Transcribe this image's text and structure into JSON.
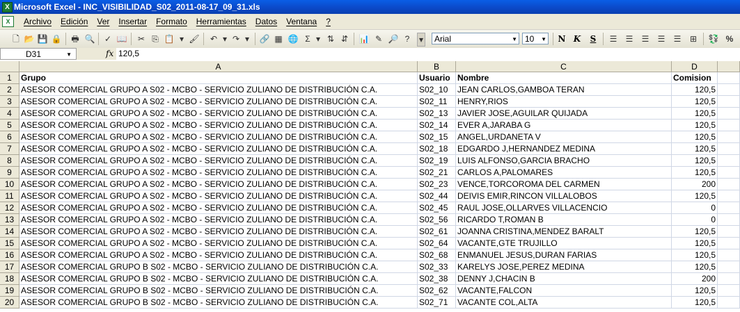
{
  "window": {
    "title": "Microsoft Excel - INC_VISIBILIDAD_S02_2011-08-17_09_31.xls"
  },
  "menu": [
    "Archivo",
    "Edición",
    "Ver",
    "Insertar",
    "Formato",
    "Herramientas",
    "Datos",
    "Ventana",
    "?"
  ],
  "toolbar": {
    "font": "Arial",
    "size": "10",
    "bold": "N",
    "italic": "K",
    "underline": "S",
    "percent": "%",
    "sum": "Σ"
  },
  "formula_bar": {
    "cell_ref": "D31",
    "fx": "fx",
    "value": "120,5"
  },
  "sheet": {
    "columns": [
      "A",
      "B",
      "C",
      "D"
    ],
    "header_row": [
      "Grupo",
      "Usuario",
      "Nombre",
      "Comision"
    ],
    "rows": [
      [
        "ASESOR COMERCIAL GRUPO A S02 - MCBO - SERVICIO ZULIANO DE DISTRIBUCIÓN C.A.",
        "S02_10",
        "JEAN  CARLOS,GAMBOA TERAN",
        "120,5"
      ],
      [
        "ASESOR COMERCIAL GRUPO A S02 - MCBO - SERVICIO ZULIANO DE DISTRIBUCIÓN C.A.",
        "S02_11",
        "HENRY,RIOS",
        "120,5"
      ],
      [
        "ASESOR COMERCIAL GRUPO A S02 - MCBO - SERVICIO ZULIANO DE DISTRIBUCIÓN C.A.",
        "S02_13",
        "JAVIER JOSE,AGUILAR QUIJADA",
        "120,5"
      ],
      [
        "ASESOR COMERCIAL GRUPO A S02 - MCBO - SERVICIO ZULIANO DE DISTRIBUCIÓN C.A.",
        "S02_14",
        "EVER A,JARABA G",
        "120,5"
      ],
      [
        "ASESOR COMERCIAL GRUPO A S02 - MCBO - SERVICIO ZULIANO DE DISTRIBUCIÓN C.A.",
        "S02_15",
        "ANGEL,URDANETA V",
        "120,5"
      ],
      [
        "ASESOR COMERCIAL GRUPO A S02 - MCBO - SERVICIO ZULIANO DE DISTRIBUCIÓN C.A.",
        "S02_18",
        "EDGARDO J,HERNANDEZ MEDINA",
        "120,5"
      ],
      [
        "ASESOR COMERCIAL GRUPO A S02 - MCBO - SERVICIO ZULIANO DE DISTRIBUCIÓN C.A.",
        "S02_19",
        "LUIS ALFONSO,GARCIA BRACHO",
        "120,5"
      ],
      [
        "ASESOR COMERCIAL GRUPO A S02 - MCBO - SERVICIO ZULIANO DE DISTRIBUCIÓN C.A.",
        "S02_21",
        "CARLOS A,PALOMARES",
        "120,5"
      ],
      [
        "ASESOR COMERCIAL GRUPO A S02 - MCBO - SERVICIO ZULIANO DE DISTRIBUCIÓN C.A.",
        "S02_23",
        "VENCE,TORCOROMA DEL CARMEN",
        "200"
      ],
      [
        "ASESOR COMERCIAL GRUPO A S02 - MCBO - SERVICIO ZULIANO DE DISTRIBUCIÓN C.A.",
        "S02_44",
        "DEIVIS EMIR,RINCON VILLALOBOS",
        "120,5"
      ],
      [
        "ASESOR COMERCIAL GRUPO A S02 - MCBO - SERVICIO ZULIANO DE DISTRIBUCIÓN C.A.",
        "S02_45",
        "RAUL JOSE,OLLARVES VILLACENCIO",
        "0"
      ],
      [
        "ASESOR COMERCIAL GRUPO A S02 - MCBO - SERVICIO ZULIANO DE DISTRIBUCIÓN C.A.",
        "S02_56",
        "RICARDO T,ROMAN B",
        "0"
      ],
      [
        "ASESOR COMERCIAL GRUPO A S02 - MCBO - SERVICIO ZULIANO DE DISTRIBUCIÓN C.A.",
        "S02_61",
        "JOANNA CRISTINA,MENDEZ BARALT",
        "120,5"
      ],
      [
        "ASESOR COMERCIAL GRUPO A S02 - MCBO - SERVICIO ZULIANO DE DISTRIBUCIÓN C.A.",
        "S02_64",
        "VACANTE,GTE TRUJILLO",
        "120,5"
      ],
      [
        "ASESOR COMERCIAL GRUPO A S02 - MCBO - SERVICIO ZULIANO DE DISTRIBUCIÓN C.A.",
        "S02_68",
        "ENMANUEL JESUS,DURAN FARIAS",
        "120,5"
      ],
      [
        "ASESOR COMERCIAL GRUPO B S02 - MCBO - SERVICIO ZULIANO DE DISTRIBUCIÓN C.A.",
        "S02_33",
        "KARELYS JOSE,PEREZ MEDINA",
        "120,5"
      ],
      [
        "ASESOR COMERCIAL GRUPO B S02 - MCBO - SERVICIO ZULIANO DE DISTRIBUCIÓN C.A.",
        "S02_38",
        "DENNY J,CHACIN B",
        "200"
      ],
      [
        "ASESOR COMERCIAL GRUPO B S02 - MCBO - SERVICIO ZULIANO DE DISTRIBUCIÓN C.A.",
        "S02_62",
        "VACANTE,FALCON",
        "120,5"
      ],
      [
        "ASESOR COMERCIAL GRUPO B S02 - MCBO - SERVICIO ZULIANO DE DISTRIBUCIÓN C.A.",
        "S02_71",
        "VACANTE COL,ALTA",
        "120,5"
      ]
    ]
  }
}
